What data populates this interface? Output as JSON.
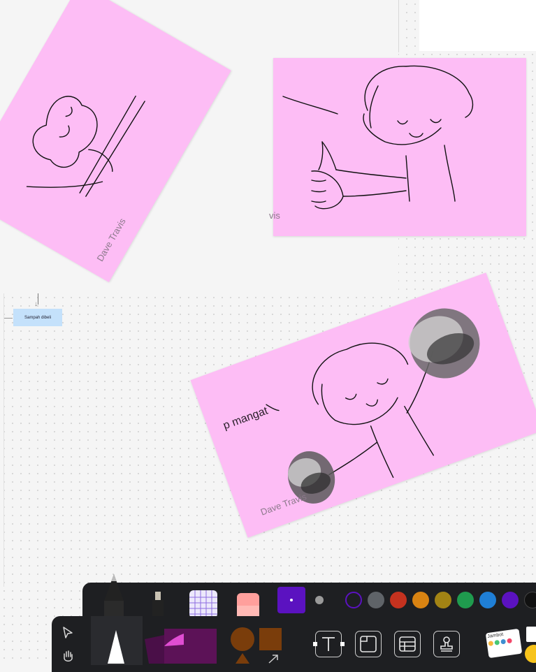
{
  "canvas": {
    "notes": [
      {
        "author": "Dave Travis",
        "text": ""
      },
      {
        "author": "vis",
        "text": ""
      },
      {
        "author": "Dave Travis",
        "text": "p mangat"
      }
    ],
    "flow_box": {
      "label": "Sampah dibeli"
    }
  },
  "toolbar": {
    "pen_tools": [
      "pen",
      "marker",
      "grid-sticky",
      "eraser"
    ],
    "selected_color_hex": "#5b1fb5",
    "colors": [
      "#1e1f22",
      "#5f6368",
      "#c5321f",
      "#d98312",
      "#a28314",
      "#1f9b4e",
      "#1f7fd6",
      "#5b12c0",
      "#111111"
    ],
    "bottom_tools": [
      "select",
      "hand",
      "pen-stack",
      "sticky-note-stack",
      "shapes",
      "text",
      "frame",
      "table",
      "stamp",
      "stickers"
    ],
    "sticker_label": "Jambot"
  }
}
